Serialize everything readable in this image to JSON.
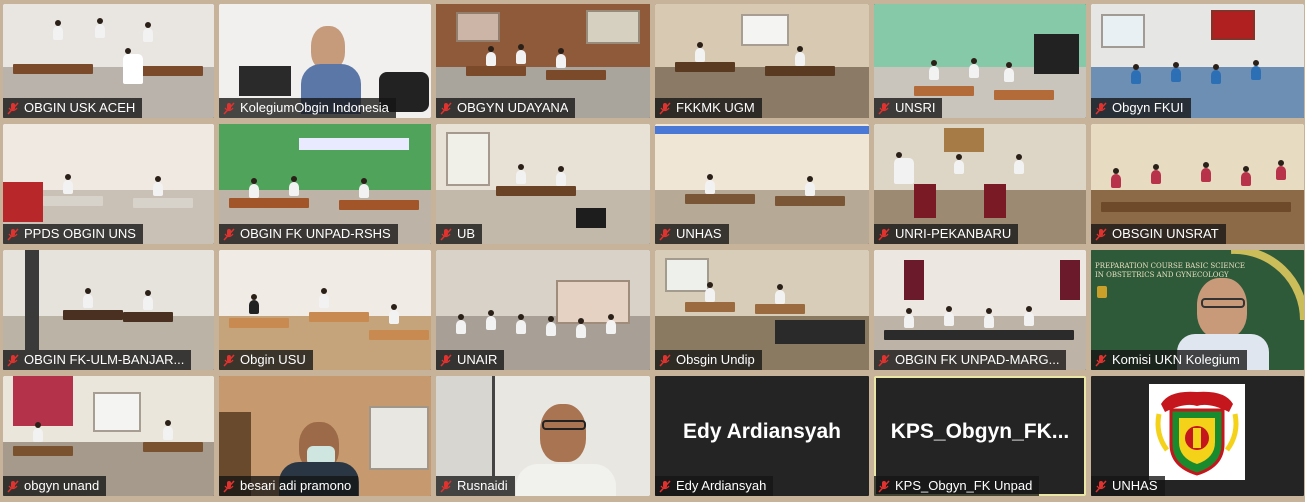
{
  "meeting": {
    "participants": [
      {
        "name": "OBGIN USK ACEH",
        "type": "video",
        "muted": true
      },
      {
        "name": "KolegiumObgin Indonesia",
        "type": "video",
        "muted": true
      },
      {
        "name": "OBGYN UDAYANA",
        "type": "video",
        "muted": true
      },
      {
        "name": "FKKMK UGM",
        "type": "video",
        "muted": true
      },
      {
        "name": "UNSRI",
        "type": "video",
        "muted": true
      },
      {
        "name": "Obgyn FKUI",
        "type": "video",
        "muted": true
      },
      {
        "name": "PPDS OBGIN UNS",
        "type": "video",
        "muted": true
      },
      {
        "name": "OBGIN FK UNPAD-RSHS",
        "type": "video",
        "muted": true
      },
      {
        "name": "UB",
        "type": "video",
        "muted": true
      },
      {
        "name": "UNHAS",
        "type": "video",
        "muted": true
      },
      {
        "name": "UNRI-PEKANBARU",
        "type": "video",
        "muted": true
      },
      {
        "name": "OBSGIN UNSRAT",
        "type": "video",
        "muted": true
      },
      {
        "name": "OBGIN FK-ULM-BANJAR...",
        "type": "video",
        "muted": true
      },
      {
        "name": "Obgin USU",
        "type": "video",
        "muted": true
      },
      {
        "name": "UNAIR",
        "type": "video",
        "muted": true
      },
      {
        "name": "Obsgin Undip",
        "type": "video",
        "muted": true
      },
      {
        "name": "OBGIN FK UNPAD-MARG...",
        "type": "video",
        "muted": true
      },
      {
        "name": "Komisi UKN Kolegium",
        "type": "video",
        "muted": true
      },
      {
        "name": "obgyn unand",
        "type": "video",
        "muted": true
      },
      {
        "name": "besari adi pramono",
        "type": "video",
        "muted": true
      },
      {
        "name": "Rusnaidi",
        "type": "video",
        "muted": true
      },
      {
        "name": "Edy Ardiansyah",
        "type": "avatar",
        "display": "Edy Ardiansyah",
        "muted": true
      },
      {
        "name": "KPS_Obgyn_FK Unpad",
        "type": "avatar",
        "display": "KPS_Obgyn_FK...",
        "muted": true
      },
      {
        "name": "UNHAS",
        "type": "logo",
        "muted": true
      }
    ],
    "slide_text": {
      "line1": "PREPARATION COURSE BASIC SCIENCE",
      "line2": "IN OBSTETRICS AND GYNECOLOGY"
    }
  },
  "colors": {
    "tile_bg": "#242424",
    "page_bg": "#c7b29a",
    "mic_muted": "#e0322e",
    "highlight": "#e9e6a6"
  }
}
